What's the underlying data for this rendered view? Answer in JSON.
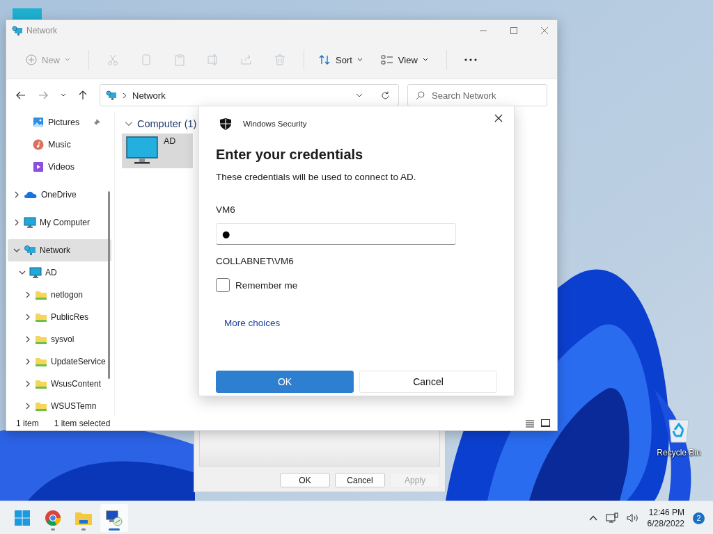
{
  "desktop": {
    "icons": [
      {
        "label": "Recycle Bin",
        "kind": "recycle-bin"
      }
    ]
  },
  "properties_window": {
    "buttons": [
      {
        "label": "OK",
        "disabled": false
      },
      {
        "label": "Cancel",
        "disabled": false
      },
      {
        "label": "Apply",
        "disabled": true
      }
    ]
  },
  "explorer": {
    "title": "Network",
    "toolbar": [
      {
        "kind": "new",
        "label": "New",
        "disabled": true
      },
      {
        "kind": "separator"
      },
      {
        "kind": "cut",
        "disabled": true
      },
      {
        "kind": "copy",
        "disabled": true
      },
      {
        "kind": "paste",
        "disabled": true
      },
      {
        "kind": "rename",
        "disabled": true
      },
      {
        "kind": "share",
        "disabled": true
      },
      {
        "kind": "delete",
        "disabled": true
      },
      {
        "kind": "separator"
      },
      {
        "kind": "sort",
        "label": "Sort",
        "disabled": false
      },
      {
        "kind": "view",
        "label": "View",
        "disabled": false
      },
      {
        "kind": "separator"
      },
      {
        "kind": "more",
        "disabled": false
      }
    ],
    "address": {
      "path": "Network"
    },
    "search": {
      "placeholder": "Search Network"
    },
    "sidebar": {
      "quick_access": [
        {
          "label": "Pictures",
          "kind": "pictures",
          "pinned": true,
          "selected": false
        },
        {
          "label": "Music",
          "kind": "music",
          "pinned": false,
          "selected": false
        },
        {
          "label": "Videos",
          "kind": "videos",
          "pinned": false,
          "selected": false
        }
      ],
      "tree": [
        {
          "label": "OneDrive",
          "kind": "cloud",
          "expanded": false,
          "selected": false
        },
        {
          "label": "My Computer",
          "kind": "computer",
          "expanded": false,
          "selected": false
        },
        {
          "label": "Network",
          "kind": "network",
          "expanded": true,
          "selected": true,
          "children": [
            {
              "label": "AD",
              "kind": "computer",
              "expanded": true,
              "selected": false,
              "children": [
                {
                  "label": "netlogon",
                  "kind": "folder",
                  "expanded": false,
                  "selected": false
                },
                {
                  "label": "PublicRes",
                  "kind": "folder",
                  "expanded": false,
                  "selected": false
                },
                {
                  "label": "sysvol",
                  "kind": "folder",
                  "expanded": false,
                  "selected": false
                },
                {
                  "label": "UpdateService",
                  "kind": "folder",
                  "expanded": false,
                  "selected": false
                },
                {
                  "label": "WsusContent",
                  "kind": "folder",
                  "expanded": false,
                  "selected": false
                },
                {
                  "label": "WSUSTemn",
                  "kind": "folder",
                  "expanded": false,
                  "selected": false
                }
              ]
            }
          ]
        }
      ]
    },
    "content": {
      "groups": [
        {
          "title": "Computer (1)",
          "expanded": true,
          "items": [
            {
              "name": "AD",
              "selected": true
            }
          ]
        }
      ]
    },
    "status_bar": {
      "count": "1 item",
      "selection": "1 item selected"
    }
  },
  "dialog": {
    "app": "Windows Security",
    "heading": "Enter your credentials",
    "message": "These credentials will be used to connect to AD.",
    "user_label": "VM6",
    "password": {
      "value": "●"
    },
    "account": "COLLABNET\\VM6",
    "remember": {
      "label": "Remember me",
      "checked": false
    },
    "link": "More choices",
    "buttons": [
      {
        "label": "OK",
        "kind": "primary"
      },
      {
        "label": "Cancel",
        "kind": "secondary"
      }
    ]
  },
  "taskbar": {
    "apps": [
      {
        "kind": "start",
        "running": false,
        "active": false
      },
      {
        "kind": "chrome",
        "running": true,
        "active": false
      },
      {
        "kind": "explorer",
        "running": true,
        "active": false
      },
      {
        "kind": "network",
        "running": true,
        "active": true
      }
    ],
    "tray": {
      "time": "12:46 PM",
      "date": "6/28/2022",
      "notifications": "2"
    }
  }
}
